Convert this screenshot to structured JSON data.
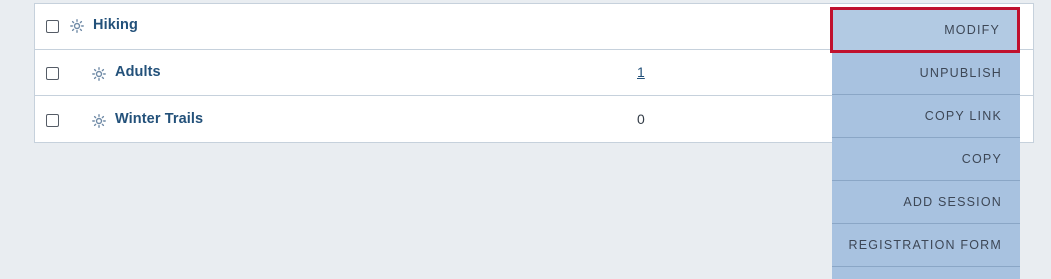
{
  "rows": [
    {
      "label": "Hiking",
      "count": "",
      "count_is_link": false,
      "level": 0
    },
    {
      "label": "Adults",
      "count": "1",
      "count_is_link": true,
      "level": 1
    },
    {
      "label": "Winter Trails",
      "count": "0",
      "count_is_link": false,
      "level": 1
    }
  ],
  "menu": {
    "items": [
      {
        "label": "MODIFY",
        "highlighted": true
      },
      {
        "label": "UNPUBLISH"
      },
      {
        "label": "COPY LINK"
      },
      {
        "label": "COPY"
      },
      {
        "label": "ADD SESSION"
      },
      {
        "label": "REGISTRATION FORM"
      }
    ]
  },
  "colors": {
    "background": "#e9edf1",
    "label": "#23517a",
    "menu_bg": "#a8c2e0",
    "highlight_border": "#c0112e",
    "icon": "#6f8aa6"
  },
  "icons": {
    "row_icon": "sun-icon"
  }
}
